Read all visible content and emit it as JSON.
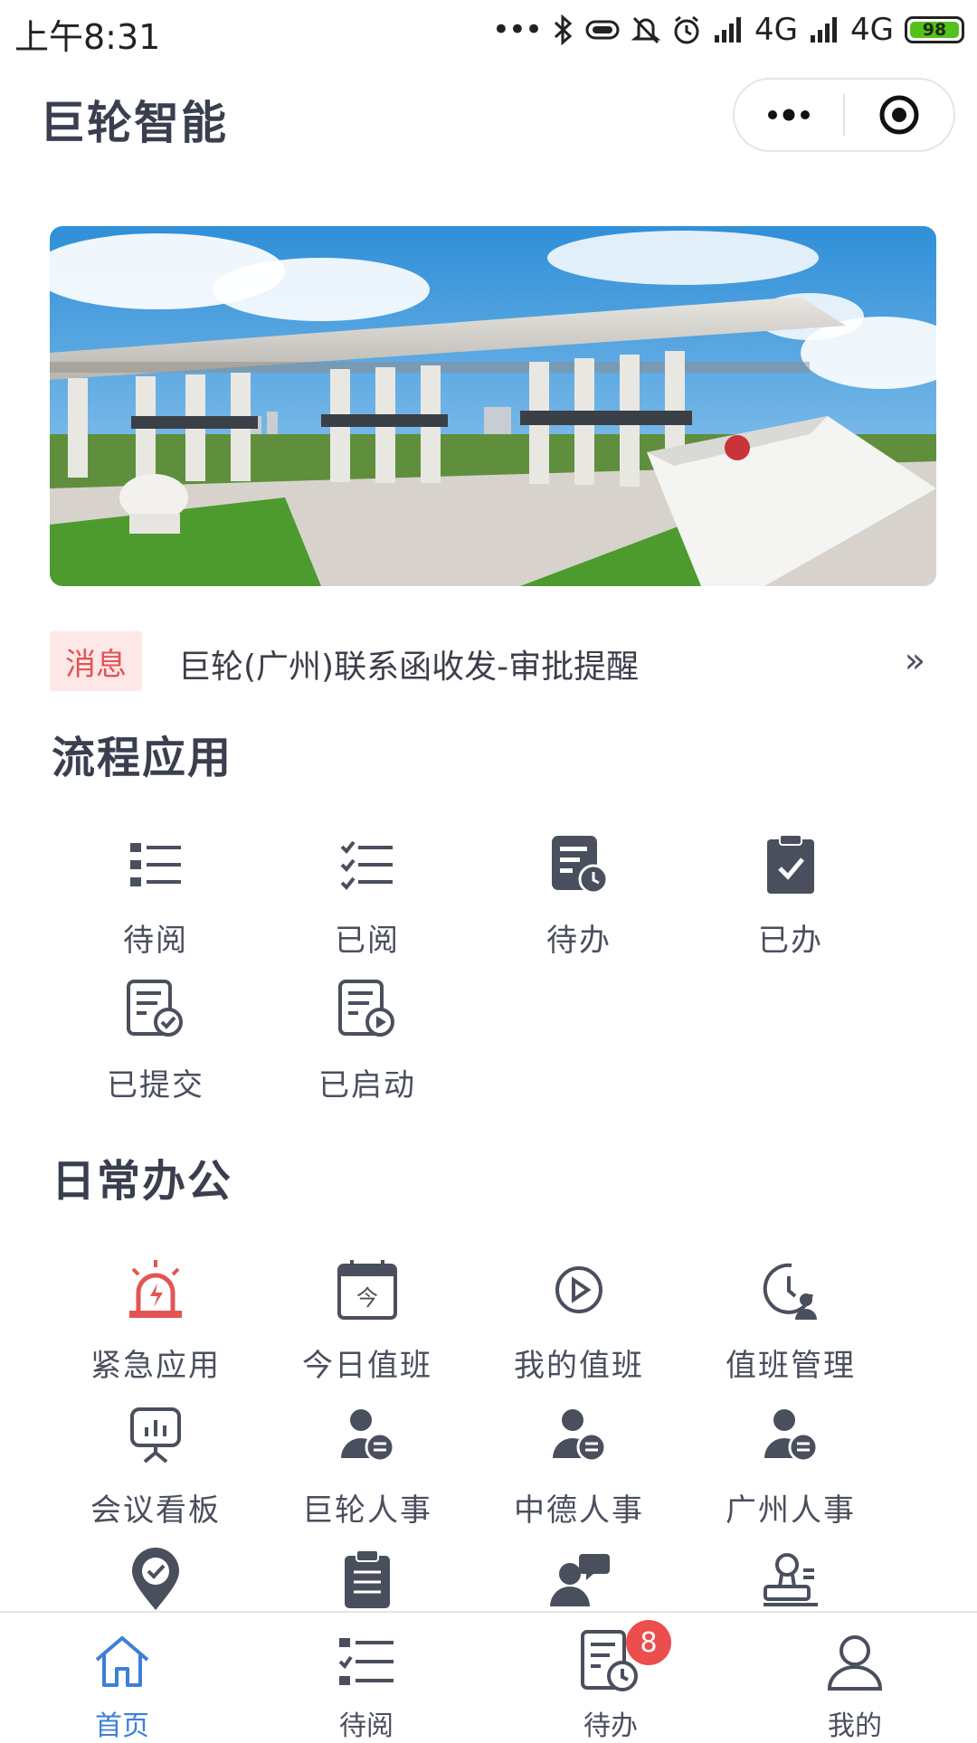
{
  "status_bar": {
    "time": "上午8:31",
    "battery": "98",
    "network_1": "4G",
    "network_2": "4G"
  },
  "header": {
    "title": "巨轮智能"
  },
  "notice": {
    "tag": "消息",
    "text": "巨轮(广州)联系函收发-审批提醒",
    "more": "»"
  },
  "sections": {
    "workflow": {
      "title": "流程应用",
      "items": [
        {
          "label": "待阅",
          "icon": "list-icon"
        },
        {
          "label": "已阅",
          "icon": "checklist-icon"
        },
        {
          "label": "待办",
          "icon": "doc-clock-icon"
        },
        {
          "label": "已办",
          "icon": "clipboard-check-icon"
        },
        {
          "label": "已提交",
          "icon": "doc-check-icon"
        },
        {
          "label": "已启动",
          "icon": "doc-play-icon"
        }
      ]
    },
    "office": {
      "title": "日常办公",
      "items": [
        {
          "label": "紧急应用",
          "icon": "alarm-icon",
          "color": "#e25554"
        },
        {
          "label": "今日值班",
          "icon": "calendar-today-icon",
          "calendar_text": "今"
        },
        {
          "label": "我的值班",
          "icon": "play-circle-icon"
        },
        {
          "label": "值班管理",
          "icon": "clock-user-icon"
        },
        {
          "label": "会议看板",
          "icon": "presentation-board-icon"
        },
        {
          "label": "巨轮人事",
          "icon": "user-list-icon"
        },
        {
          "label": "中德人事",
          "icon": "user-list-icon"
        },
        {
          "label": "广州人事",
          "icon": "user-list-icon"
        },
        {
          "label": "",
          "icon": "location-check-icon"
        },
        {
          "label": "",
          "icon": "notepad-icon"
        },
        {
          "label": "",
          "icon": "user-chat-icon"
        },
        {
          "label": "",
          "icon": "stamp-icon"
        }
      ]
    }
  },
  "tabbar": {
    "tabs": [
      {
        "label": "首页",
        "icon": "home-icon",
        "active": true
      },
      {
        "label": "待阅",
        "icon": "list-icon"
      },
      {
        "label": "待办",
        "icon": "doc-clock-icon",
        "badge": "8"
      },
      {
        "label": "我的",
        "icon": "user-icon"
      }
    ]
  },
  "colors": {
    "accent": "#3d7fd8",
    "icon": "#4a4f5e",
    "alert": "#e25554",
    "badge": "#ec4d4d"
  }
}
